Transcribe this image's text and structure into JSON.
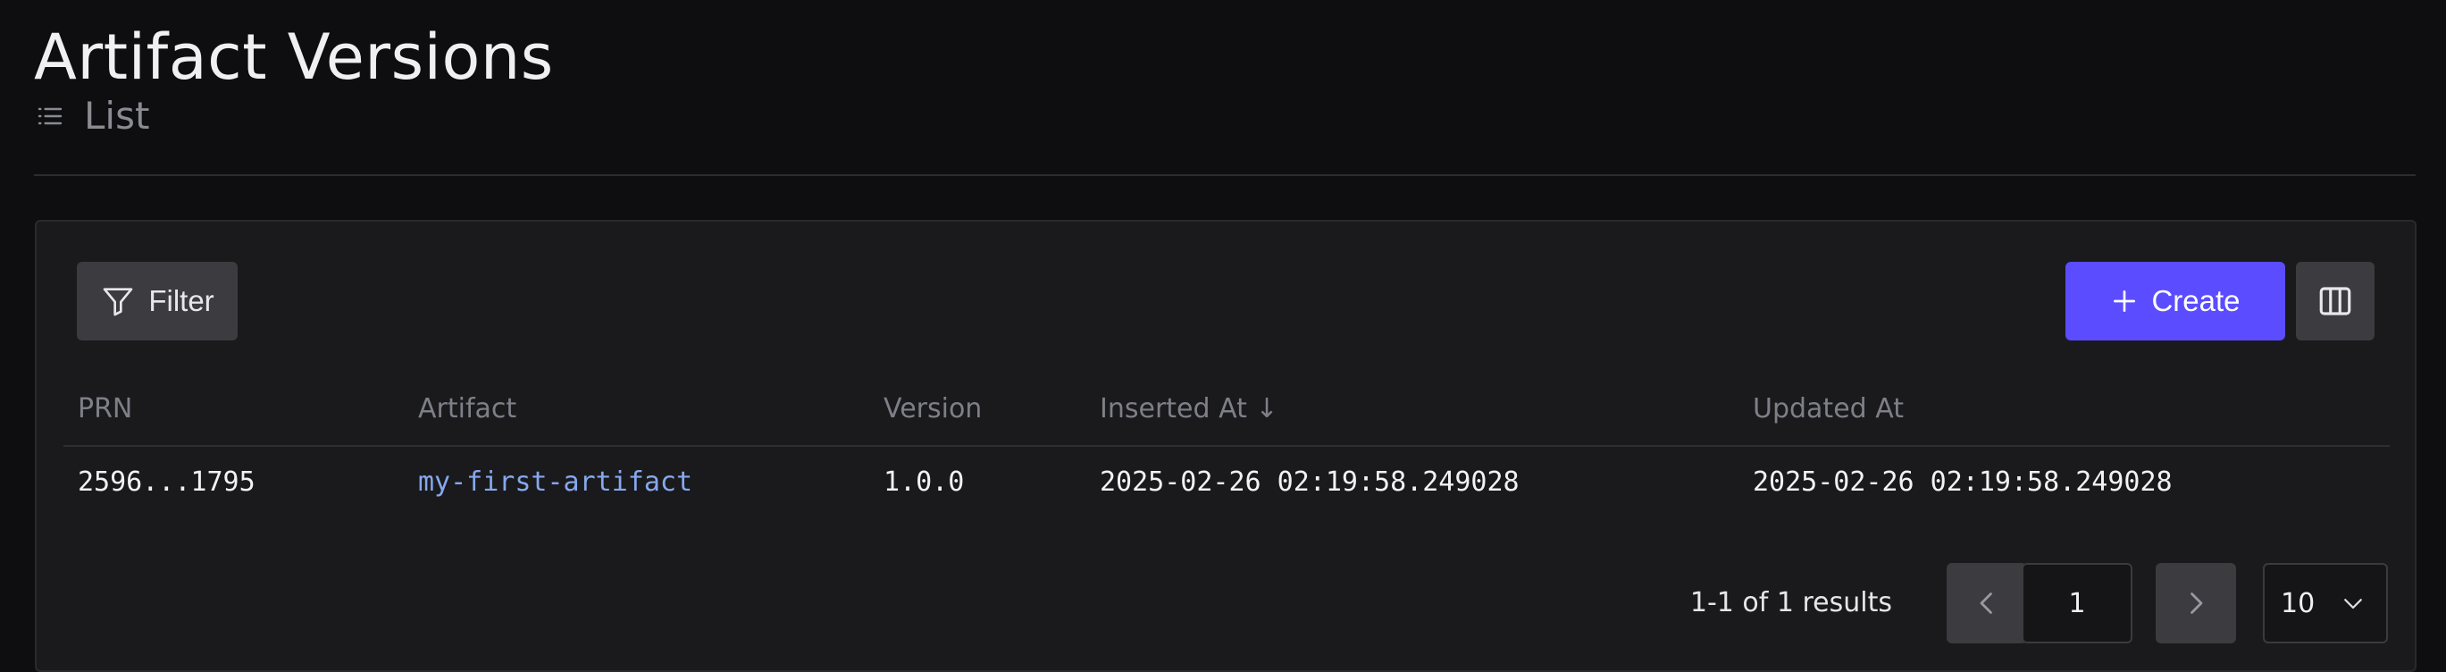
{
  "page": {
    "title": "Artifact Versions",
    "subtitle": "List",
    "subtitle_icon": "list-icon"
  },
  "toolbar": {
    "filter_label": "Filter",
    "filter_icon": "funnel-icon",
    "create_label": "Create",
    "create_icon": "plus-icon",
    "columns_icon": "columns-icon"
  },
  "table": {
    "headers": [
      "PRN",
      "Artifact",
      "Version",
      "Inserted At",
      "Updated At"
    ],
    "sort_indicator": "↓",
    "rows": [
      {
        "prn": "2596...1795",
        "artifact": "my-first-artifact",
        "version": "1.0.0",
        "inserted_at": "2025-02-26 02:19:58.249028",
        "updated_at": "2025-02-26 02:19:58.249028"
      }
    ]
  },
  "pagination": {
    "summary": "1-1 of 1 results",
    "current_page": "1",
    "per_page": "10"
  },
  "colors": {
    "background": "#0e0e10",
    "card": "#1a1a1d",
    "primary": "#5b4dff",
    "link": "#86a8ee",
    "muted": "#7e7f87"
  }
}
